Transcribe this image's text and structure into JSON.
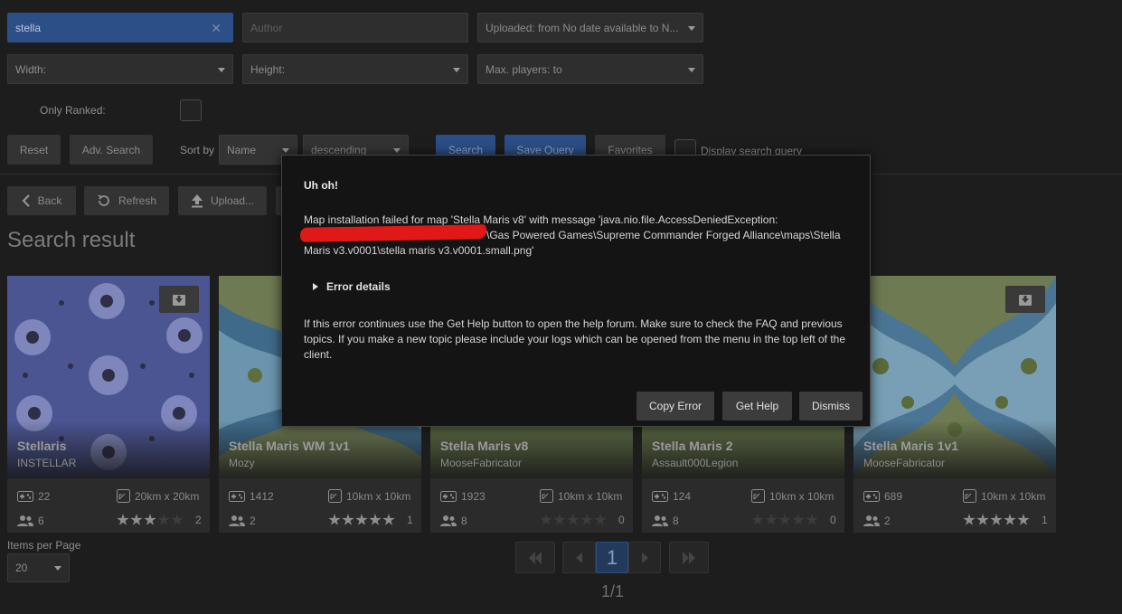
{
  "search": {
    "query_value": "stella",
    "author_placeholder": "Author",
    "uploaded_value": "Uploaded: from No date available to N...",
    "width_value": "Width:",
    "height_value": "Height:",
    "max_players_value": "Max. players:  to",
    "only_ranked_label": "Only Ranked:",
    "reset_label": "Reset",
    "adv_search_label": "Adv. Search",
    "sort_by_label": "Sort by",
    "sort_field_value": "Name",
    "sort_order_value": "descending",
    "search_label": "Search",
    "save_query_label": "Save Query",
    "favorites_label": "Favorites",
    "display_query_label": "Display search query"
  },
  "toolbar": {
    "back_label": "Back",
    "refresh_label": "Refresh",
    "upload_label": "Upload..."
  },
  "results_title": "Search result",
  "cards": [
    {
      "name": "Stellaris",
      "author": "INSTELLAR",
      "plays": "22",
      "size": "20km x 20km",
      "players": "6",
      "rating": 3,
      "rating_count": "2"
    },
    {
      "name": "Stella Maris WM 1v1",
      "author": "Mozy",
      "plays": "1412",
      "size": "10km x 10km",
      "players": "2",
      "rating": 5,
      "rating_count": "1"
    },
    {
      "name": "Stella Maris v8",
      "author": "MooseFabricator",
      "plays": "1923",
      "size": "10km x 10km",
      "players": "8",
      "rating": 0,
      "rating_count": "0"
    },
    {
      "name": "Stella Maris 2",
      "author": "Assault000Legion",
      "plays": "124",
      "size": "10km x 10km",
      "players": "8",
      "rating": 0,
      "rating_count": "0"
    },
    {
      "name": "Stella Maris 1v1",
      "author": "MooseFabricator",
      "plays": "689",
      "size": "10km x 10km",
      "players": "2",
      "rating": 5,
      "rating_count": "1"
    }
  ],
  "pagination": {
    "items_per_page_label": "Items per Page",
    "items_per_page_value": "20",
    "current_page": "1",
    "page_summary": "1/1"
  },
  "dialog": {
    "title": "Uh oh!",
    "message_line1": "Map installation failed for map 'Stella Maris v8' with message 'java.nio.file.AccessDeniedException:",
    "message_line2": "\\Gas Powered Games\\Supreme Commander Forged Alliance\\maps\\Stella",
    "message_line3": "Maris v3.v0001\\stella maris v3.v0001.small.png'",
    "details_label": "Error details",
    "help_text": "If this error continues use the Get Help button to open the help forum. Make sure to check the FAQ and previous topics. If you make a new topic please include your logs which can be opened from the menu in the top left of the client.",
    "copy_error_label": "Copy Error",
    "get_help_label": "Get Help",
    "dismiss_label": "Dismiss"
  },
  "colors": {
    "accent": "#2d4f87",
    "background": "#1d1d1d",
    "redaction": "#e01818"
  }
}
